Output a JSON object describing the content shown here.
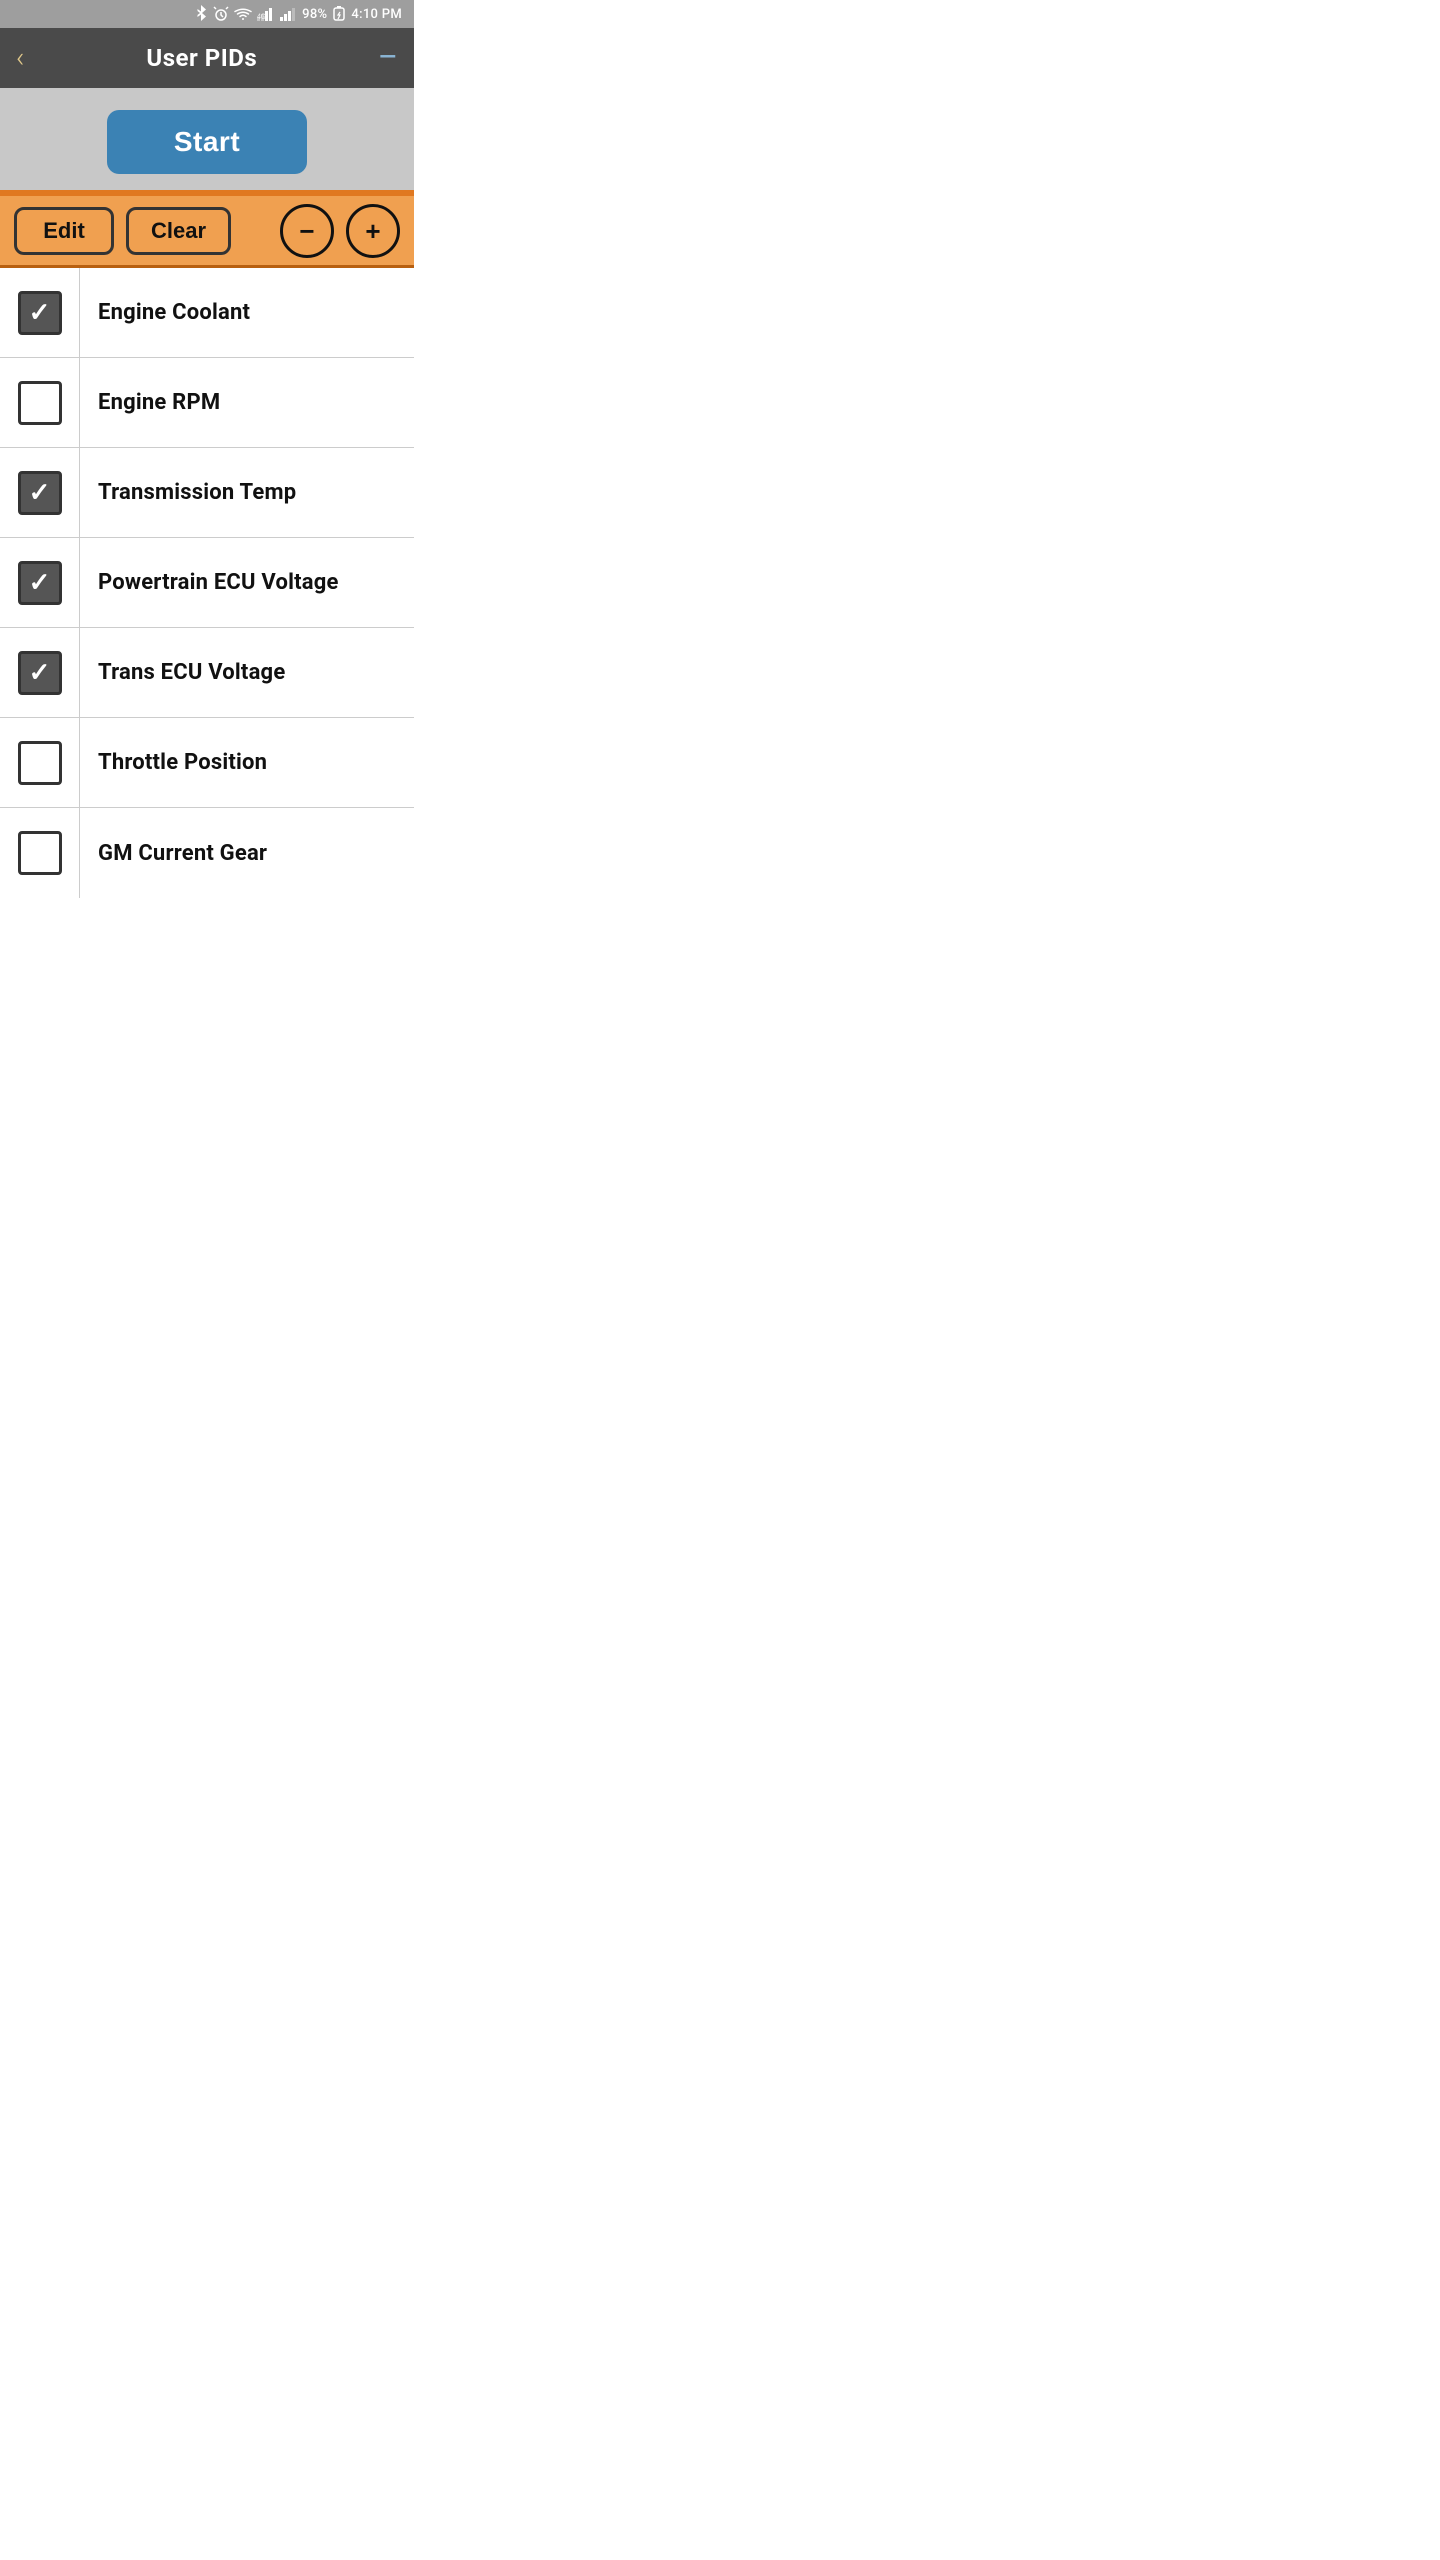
{
  "statusBar": {
    "battery": "98%",
    "time": "4:10 PM",
    "icons": [
      "bluetooth",
      "alarm",
      "wifi",
      "signal",
      "battery-charge"
    ]
  },
  "navBar": {
    "backLabel": "‹",
    "title": "User PIDs",
    "menuLabel": "—"
  },
  "startButton": {
    "label": "Start"
  },
  "toolbar": {
    "editLabel": "Edit",
    "clearLabel": "Clear",
    "decrementLabel": "−",
    "incrementLabel": "+"
  },
  "pidItems": [
    {
      "id": 1,
      "label": "Engine Coolant",
      "checked": true
    },
    {
      "id": 2,
      "label": "Engine RPM",
      "checked": false
    },
    {
      "id": 3,
      "label": "Transmission Temp",
      "checked": true
    },
    {
      "id": 4,
      "label": "Powertrain ECU Voltage",
      "checked": true
    },
    {
      "id": 5,
      "label": "Trans ECU Voltage",
      "checked": true
    },
    {
      "id": 6,
      "label": "Throttle Position",
      "checked": false
    },
    {
      "id": 7,
      "label": "GM Current Gear",
      "checked": false
    }
  ],
  "colors": {
    "navBg": "#4a4a4a",
    "startBtn": "#3b82b4",
    "toolbar": "#f0a050",
    "divider": "#e07820"
  }
}
